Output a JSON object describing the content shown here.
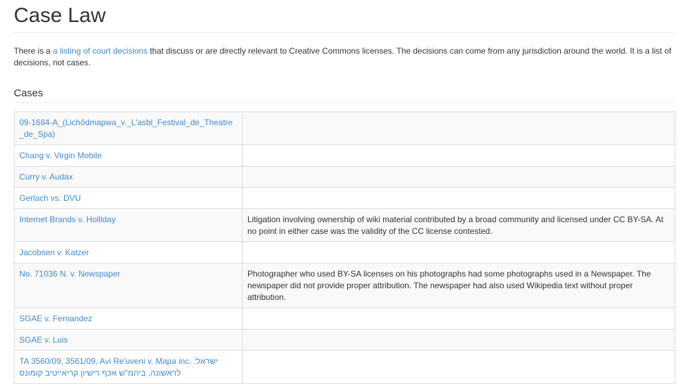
{
  "page": {
    "title": "Case Law"
  },
  "intro": {
    "before_link": "There is a ",
    "link_text": "a listing of court decisions",
    "after_link": " that discuss or are directly relevant to Creative Commons licenses. The decisions can come from any jurisdiction around the world. It is a list of decisions, not cases."
  },
  "cases_section": {
    "title": "Cases",
    "rows": [
      {
        "name": "09-1684-A_(Lichôdmapwa_v._L'asbl_Festival_de_Theatre_de_Spa)",
        "description": ""
      },
      {
        "name": "Chang v. Virgin Mobile",
        "description": ""
      },
      {
        "name": "Curry v. Audax",
        "description": ""
      },
      {
        "name": "Gerlach vs. DVU",
        "description": ""
      },
      {
        "name": "Internet Brands v. Holliday",
        "description": "Litigation involving ownership of wiki material contributed by a broad community and licensed under CC BY-SA. At no point in either case was the validity of the CC license contested."
      },
      {
        "name": "Jacobsen v. Katzer",
        "description": ""
      },
      {
        "name": "No. 71036 N. v. Newspaper",
        "description": "Photographer who used BY-SA licenses on his photographs had some photographs used in a Newspaper. The newspaper did not provide proper attribution. The newspaper had also used Wikipedia text without proper attribution."
      },
      {
        "name": "SGAE v. Fernandez",
        "description": ""
      },
      {
        "name": "SGAE v. Luis",
        "description": ""
      },
      {
        "name": "TA 3560/09, 3561/09, Avi Re'uveni v. Mapa inc. ישראל: לראשונה, ביהמ\"ש אכף רישיון קריאייטיב קומונס",
        "description": ""
      }
    ]
  },
  "colors": {
    "link": "#428bca",
    "text": "#333333",
    "row_stripe": "#f9f9f9",
    "border": "#dddddd"
  }
}
